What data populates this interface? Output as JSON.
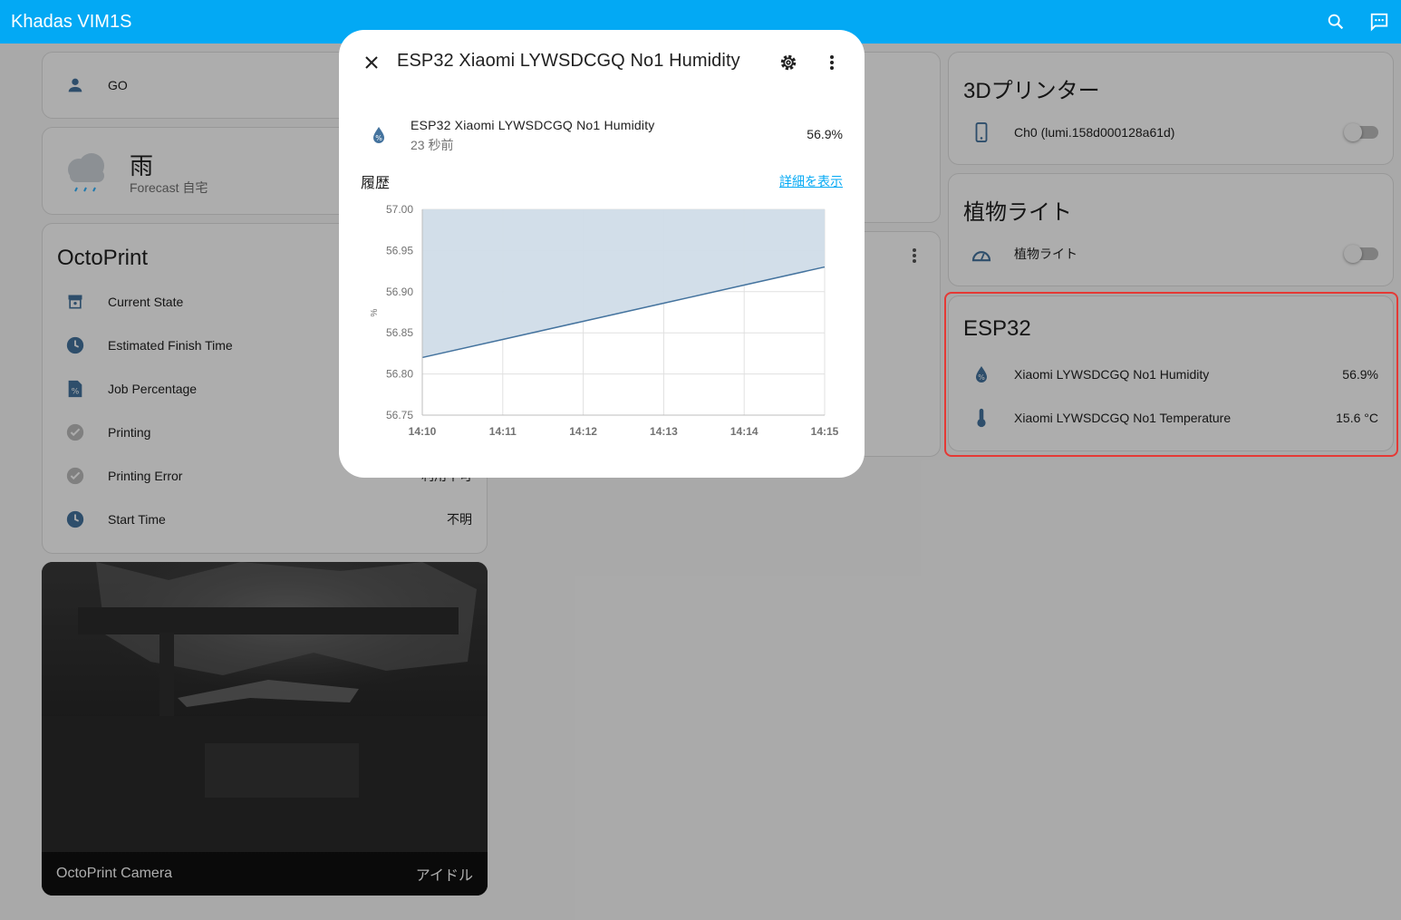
{
  "app": {
    "title": "Khadas VIM1S"
  },
  "header": {
    "search_icon": "search-icon",
    "assist_icon": "assist-icon"
  },
  "person_card": {
    "name": "GO"
  },
  "weather_card": {
    "condition": "雨",
    "subtitle": "Forecast 自宅"
  },
  "octoprint_card": {
    "title": "OctoPrint",
    "rows": [
      {
        "label": "Current State",
        "value": ""
      },
      {
        "label": "Estimated Finish Time",
        "value": ""
      },
      {
        "label": "Job Percentage",
        "value": ""
      },
      {
        "label": "Printing",
        "value": ""
      },
      {
        "label": "Printing Error",
        "value": "利用不可"
      },
      {
        "label": "Start Time",
        "value": "不明"
      }
    ]
  },
  "camera_card": {
    "name": "OctoPrint Camera",
    "state": "アイドル"
  },
  "printer_card": {
    "title": "3Dプリンター",
    "entity": "Ch0 (lumi.158d000128a61d)"
  },
  "plant_card": {
    "title": "植物ライト",
    "entity": "植物ライト"
  },
  "esp32_card": {
    "title": "ESP32",
    "rows": [
      {
        "label": "Xiaomi LYWSDCGQ No1 Humidity",
        "value": "56.9%"
      },
      {
        "label": "Xiaomi LYWSDCGQ No1 Temperature",
        "value": "15.6 °C"
      }
    ]
  },
  "dialog": {
    "title": "ESP32 Xiaomi LYWSDCGQ No1 Humidity",
    "entity_name": "ESP32 Xiaomi LYWSDCGQ No1 Humidity",
    "last_changed": "23 秒前",
    "value": "56.9%",
    "history_label": "履歴",
    "show_more": "詳細を表示"
  },
  "colors": {
    "header": "#03a9f4",
    "line": "#44739e",
    "fill": "#d0dce8",
    "icon": "#44739e",
    "highlight": "#e53935"
  },
  "chart_data": {
    "type": "area",
    "x": [
      "14:10",
      "14:11",
      "14:12",
      "14:13",
      "14:14",
      "14:15"
    ],
    "values": [
      56.82,
      56.842,
      56.864,
      56.886,
      56.908,
      56.93
    ],
    "xlabel": "",
    "ylabel": "%",
    "ylim": [
      56.75,
      57.0
    ],
    "yticks": [
      "57.00",
      "56.95",
      "56.90",
      "56.85",
      "56.80",
      "56.75"
    ],
    "grid": true
  }
}
